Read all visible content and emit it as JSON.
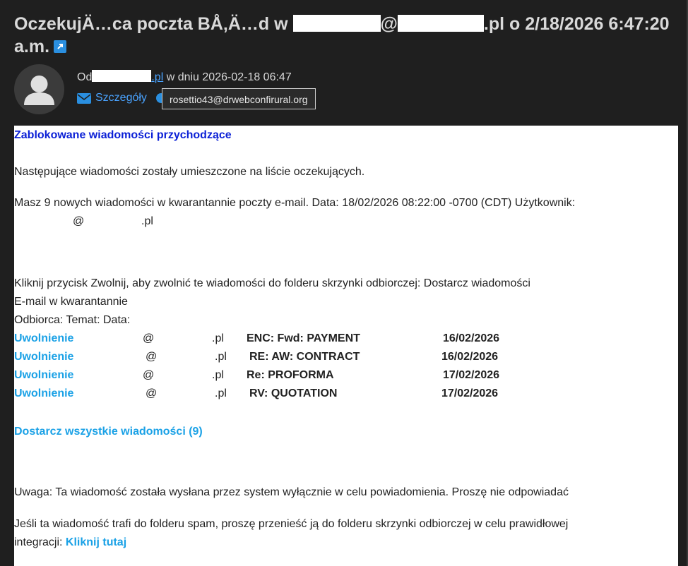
{
  "subject": {
    "part1": "OczekujÄ…ca poczta BÅ‚Ä…d w ",
    "at": "@",
    "part2": ".pl o 2/18/2026 6:47:20",
    "line2": "a.m."
  },
  "sender": {
    "prefix": "Od",
    "domain": ".pl",
    "date_text": " w dniu 2026-02-18 06:47",
    "details_label": "Szczegóły",
    "tooltip": "rosettio43@drwebconfirural.org"
  },
  "body": {
    "heading": "Zablokowane wiadomości przychodzące",
    "intro": "Następujące wiadomości zostały umieszczone na liście oczekujących.",
    "info": "Masz 9 nowych wiadomości w kwarantannie poczty e-mail. Data: 18/02/2026 08:22:00 -0700 (CDT) Użytkownik:",
    "user_at": "@",
    "user_domain": ".pl",
    "instructions": "Kliknij przycisk Zwolnij, aby zwolnić te wiadomości do folderu skrzynki odbiorczej: Dostarcz wiadomości",
    "quarantine_label": "E-mail w kwarantannie",
    "columns_label": "Odbiorca: Temat: Data:",
    "messages": [
      {
        "release": "Uwolnienie",
        "at": "@",
        "domain": ".pl",
        "subject": "ENC: Fwd: PAYMENT",
        "date": "16/02/2026"
      },
      {
        "release": "Uwolnienie",
        "at": "@",
        "domain": ".pl",
        "subject": "RE: AW: CONTRACT",
        "date": "16/02/2026"
      },
      {
        "release": "Uwolnienie",
        "at": "@",
        "domain": ".pl",
        "subject": "Re: PROFORMA",
        "date": "17/02/2026"
      },
      {
        "release": "Uwolnienie",
        "at": "@",
        "domain": ".pl",
        "subject": "RV: QUOTATION",
        "date": "17/02/2026"
      }
    ],
    "deliver_all": "Dostarcz wszystkie wiadomości (9)",
    "notice": "Uwaga: Ta wiadomość została wysłana przez system wyłącznie w celu powiadomienia. Proszę nie odpowiadać",
    "spam_line1": "Jeśli ta wiadomość trafi do folderu spam, proszę przenieść ją do folderu skrzynki odbiorczej w celu prawidłowej",
    "spam_line2": "integracji: ",
    "click_here": "Kliknij tutaj"
  },
  "icons": {
    "avatar": "user-avatar-icon",
    "details": "envelope-icon",
    "external": "external-link-icon"
  },
  "colors": {
    "heading": "#0a1fd6",
    "link": "#1aa1e6",
    "accent": "#2a8fe0"
  }
}
